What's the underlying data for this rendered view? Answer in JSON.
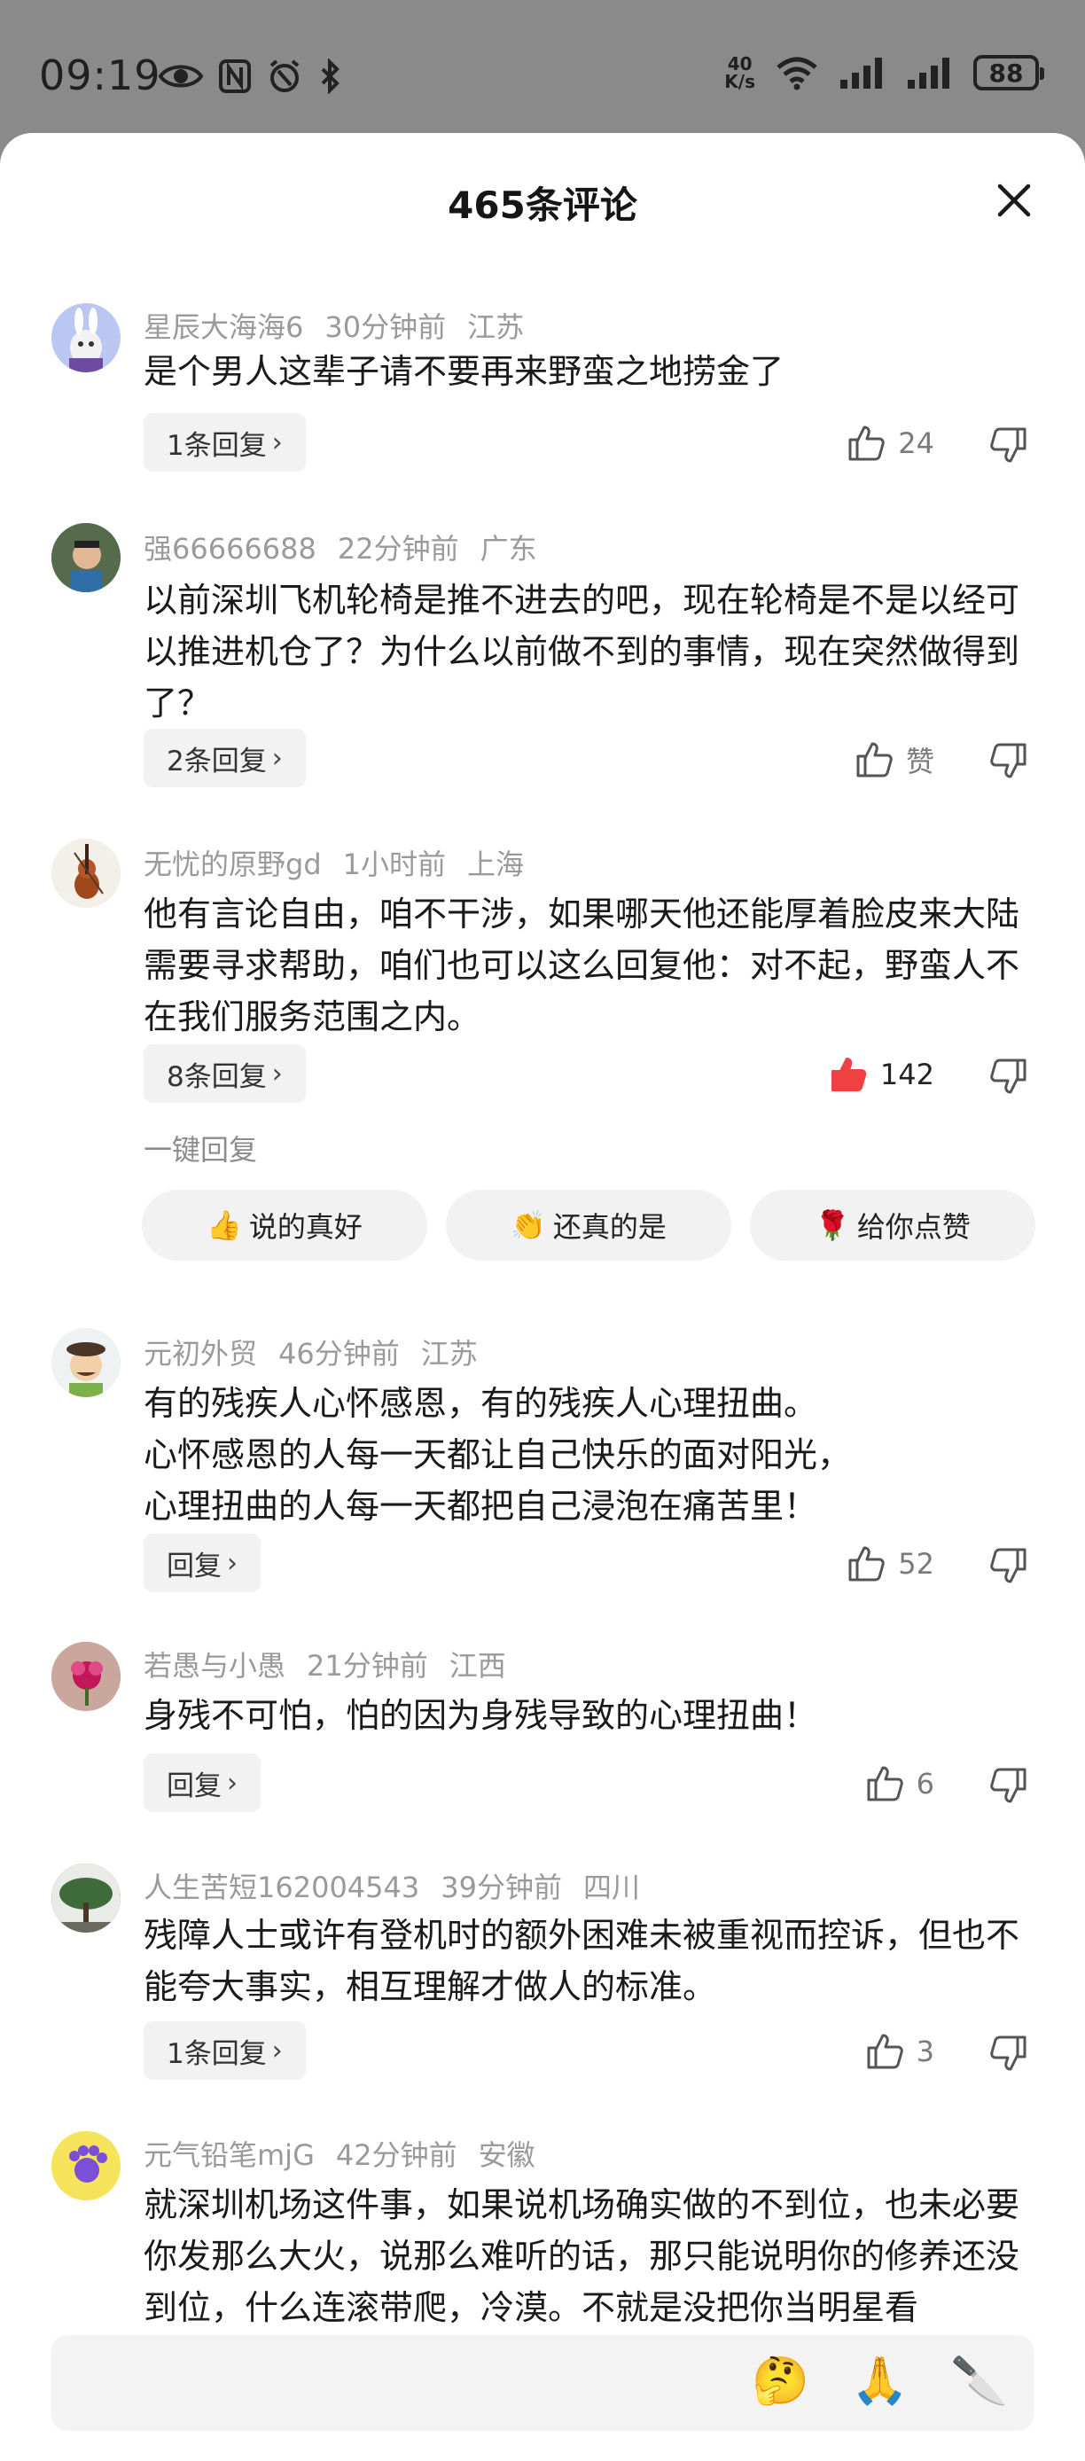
{
  "status_bar": {
    "time": "09:19",
    "speed_value": "40",
    "speed_unit": "K/s",
    "battery": "88"
  },
  "sheet": {
    "title": "465条评论"
  },
  "comments": [
    {
      "user": "星辰大海海6",
      "time": "30分钟前",
      "location": "江苏",
      "text": "是个男人这辈子请不要再来野蛮之地捞金了",
      "reply_label": "1条回复",
      "likes": "24",
      "liked": false,
      "avatar_color": "#b9c7f2"
    },
    {
      "user": "强66666688",
      "time": "22分钟前",
      "location": "广东",
      "text": "以前深圳飞机轮椅是推不进去的吧，现在轮椅是不是以经可以推进机仓了？为什么以前做不到的事情，现在突然做得到了？",
      "reply_label": "2条回复",
      "likes": "赞",
      "liked": false,
      "avatar_color": "#6b7d5e"
    },
    {
      "user": "无忧的原野gd",
      "time": "1小时前",
      "location": "上海",
      "text": "他有言论自由，咱不干涉，如果哪天他还能厚着脸皮来大陆需要寻求帮助，咱们也可以这么回复他：对不起，野蛮人不在我们服务范围之内。",
      "reply_label": "8条回复",
      "likes": "142",
      "liked": true,
      "avatar_color": "#f0ebe4"
    },
    {
      "user": "元初外贸",
      "time": "46分钟前",
      "location": "江苏",
      "text": "有的残疾人心怀感恩，有的残疾人心理扭曲。\n心怀感恩的人每一天都让自己快乐的面对阳光，\n心理扭曲的人每一天都把自己浸泡在痛苦里！",
      "reply_label": "回复",
      "likes": "52",
      "liked": false,
      "avatar_color": "#e9eef0"
    },
    {
      "user": "若愚与小愚",
      "time": "21分钟前",
      "location": "江西",
      "text": "身残不可怕，怕的因为身残导致的心理扭曲！",
      "reply_label": "回复",
      "likes": "6",
      "liked": false,
      "avatar_color": "#c9a29a"
    },
    {
      "user": "人生苦短162004543",
      "time": "39分钟前",
      "location": "四川",
      "text": "残障人士或许有登机时的额外困难未被重视而控诉，但也不能夸大事实，相互理解才做人的标准。",
      "reply_label": "1条回复",
      "likes": "3",
      "liked": false,
      "avatar_color": "#3d4a3a"
    },
    {
      "user": "元气铅笔mjG",
      "time": "42分钟前",
      "location": "安徽",
      "text": "就深圳机场这件事，如果说机场确实做的不到位，也未必要你发那么大火，说那么难听的话，那只能说明你的修养还没到位，什么连滚带爬，冷漠。不就是没把你当明星看",
      "reply_label": "",
      "likes": "",
      "liked": false,
      "avatar_color": "#f5e35a"
    }
  ],
  "quick_reply": {
    "label": "一键回复",
    "chips": [
      {
        "emoji": "👍",
        "text": "说的真好"
      },
      {
        "emoji": "👏",
        "text": "还真的是"
      },
      {
        "emoji": "🌹",
        "text": "给你点赞"
      }
    ]
  },
  "input_bar": {
    "emojis": [
      "🤔",
      "🙏",
      "🔪"
    ]
  },
  "colors": {
    "liked": "#f04142",
    "meta": "#9a9a9a",
    "text": "#1a1a1a",
    "chip_bg": "#f2f2f2"
  },
  "icons": [
    "eye-icon",
    "nfc-icon",
    "alarm-icon",
    "bluetooth-icon",
    "wifi-icon",
    "signal-icon",
    "battery-icon",
    "close-icon",
    "thumb-up-icon",
    "thumb-down-icon",
    "chevron-right-icon"
  ]
}
